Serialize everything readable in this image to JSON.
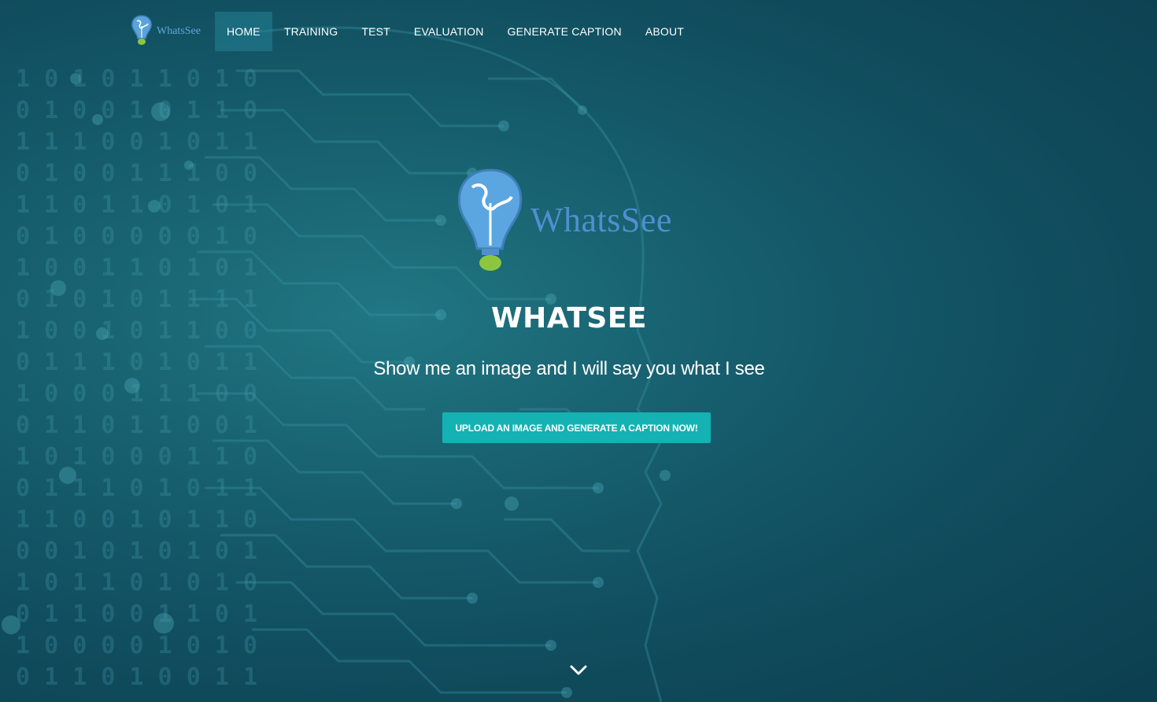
{
  "brand": {
    "logo_text": "WhatsSee",
    "logo_icon": "lightbulb-globe-icon"
  },
  "nav": {
    "items": [
      {
        "label": "HOME",
        "active": true
      },
      {
        "label": "TRAINING",
        "active": false
      },
      {
        "label": "TEST",
        "active": false
      },
      {
        "label": "EVALUATION",
        "active": false
      },
      {
        "label": "GENERATE CAPTION",
        "active": false
      },
      {
        "label": "ABOUT",
        "active": false
      }
    ]
  },
  "hero": {
    "logo_text": "WhatsSee",
    "title": "WHATSEE",
    "subtitle": "Show me an image and I will say you what I see",
    "cta_label": "UPLOAD AN IMAGE AND GENERATE A CAPTION NOW!",
    "scroll_icon": "chevron-down-icon"
  },
  "colors": {
    "background": "#0f4a5a",
    "accent": "#14b2b2",
    "logo_blue": "#4f8fd0",
    "bulb_green": "#8cc63f"
  }
}
